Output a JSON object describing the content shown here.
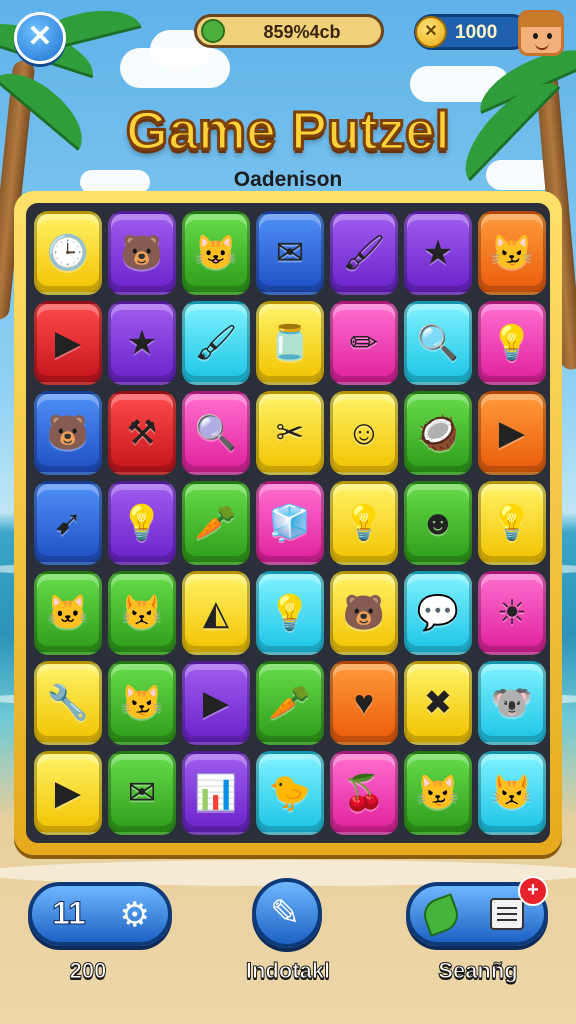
{
  "hud": {
    "progress_text": "859%4cb",
    "coins": "1000",
    "close_icon": "close-icon",
    "coin_icon": "coin-icon"
  },
  "title": "Game Putzel",
  "subtitle": "Oadenison",
  "board": {
    "rows": [
      [
        {
          "color": "yellow",
          "icon": "clock",
          "glyph": "🕒"
        },
        {
          "color": "purple",
          "icon": "bear",
          "glyph": "🐻"
        },
        {
          "color": "green",
          "icon": "cat",
          "glyph": "😺"
        },
        {
          "color": "blue",
          "icon": "envelope",
          "glyph": "✉"
        },
        {
          "color": "purple",
          "icon": "paintbrush",
          "glyph": "🖌"
        },
        {
          "color": "purple",
          "icon": "star",
          "glyph": "★"
        },
        {
          "color": "orange",
          "icon": "cat",
          "glyph": "😼"
        }
      ],
      [
        {
          "color": "red",
          "icon": "play-arrow",
          "glyph": "▶"
        },
        {
          "color": "purple",
          "icon": "star",
          "glyph": "★"
        },
        {
          "color": "cyan",
          "icon": "paintbrush",
          "glyph": "🖌"
        },
        {
          "color": "yellow",
          "icon": "pot",
          "glyph": "🫙"
        },
        {
          "color": "pink",
          "icon": "pencil",
          "glyph": "✏"
        },
        {
          "color": "cyan",
          "icon": "magnifier",
          "glyph": "🔍"
        },
        {
          "color": "pink",
          "icon": "lightbulb",
          "glyph": "💡"
        }
      ],
      [
        {
          "color": "blue",
          "icon": "bear",
          "glyph": "🐻"
        },
        {
          "color": "red",
          "icon": "tools",
          "glyph": "⚒"
        },
        {
          "color": "pink",
          "icon": "magnifier",
          "glyph": "🔍"
        },
        {
          "color": "yellow",
          "icon": "tools",
          "glyph": "✂"
        },
        {
          "color": "yellow",
          "icon": "blob",
          "glyph": "☺"
        },
        {
          "color": "green",
          "icon": "coconut",
          "glyph": "🥥"
        },
        {
          "color": "orange",
          "icon": "play-arrow",
          "glyph": "▶"
        }
      ],
      [
        {
          "color": "blue",
          "icon": "arrow",
          "glyph": "➹"
        },
        {
          "color": "purple",
          "icon": "lightbulb",
          "glyph": "💡"
        },
        {
          "color": "green",
          "icon": "carrot",
          "glyph": "🥕"
        },
        {
          "color": "pink",
          "icon": "cube",
          "glyph": "🧊"
        },
        {
          "color": "yellow",
          "icon": "lightbulb",
          "glyph": "💡"
        },
        {
          "color": "green",
          "icon": "blob",
          "glyph": "☻"
        },
        {
          "color": "yellow",
          "icon": "lightbulb",
          "glyph": "💡"
        }
      ],
      [
        {
          "color": "green",
          "icon": "cat",
          "glyph": "🐱"
        },
        {
          "color": "green",
          "icon": "cat",
          "glyph": "😾"
        },
        {
          "color": "yellow",
          "icon": "wedge",
          "glyph": "◭"
        },
        {
          "color": "cyan",
          "icon": "lightbulb",
          "glyph": "💡"
        },
        {
          "color": "yellow",
          "icon": "bear",
          "glyph": "🐻"
        },
        {
          "color": "cyan",
          "icon": "bubble",
          "glyph": "💬"
        },
        {
          "color": "pink",
          "icon": "sun",
          "glyph": "☀"
        }
      ],
      [
        {
          "color": "yellow",
          "icon": "tools",
          "glyph": "🔧"
        },
        {
          "color": "green",
          "icon": "cat",
          "glyph": "😼"
        },
        {
          "color": "purple",
          "icon": "play-arrow",
          "glyph": "▶"
        },
        {
          "color": "green",
          "icon": "carrot",
          "glyph": "🥕"
        },
        {
          "color": "orange",
          "icon": "heart",
          "glyph": "♥"
        },
        {
          "color": "yellow",
          "icon": "cross-sticks",
          "glyph": "✖"
        },
        {
          "color": "cyan",
          "icon": "koala",
          "glyph": "🐨"
        }
      ],
      [
        {
          "color": "yellow",
          "icon": "play-arrow",
          "glyph": "▶"
        },
        {
          "color": "green",
          "icon": "envelope",
          "glyph": "✉"
        },
        {
          "color": "purple",
          "icon": "bar-chart",
          "glyph": "📊"
        },
        {
          "color": "cyan",
          "icon": "bird",
          "glyph": "🐤"
        },
        {
          "color": "pink",
          "icon": "cherry",
          "glyph": "🍒"
        },
        {
          "color": "green",
          "icon": "cat",
          "glyph": "😼"
        },
        {
          "color": "cyan",
          "icon": "cat",
          "glyph": "😾"
        }
      ]
    ]
  },
  "controls": {
    "left_button_number": "11",
    "left_label": "200",
    "middle_label": "Indotakl",
    "right_label": "Seanñg",
    "badge": "+"
  }
}
